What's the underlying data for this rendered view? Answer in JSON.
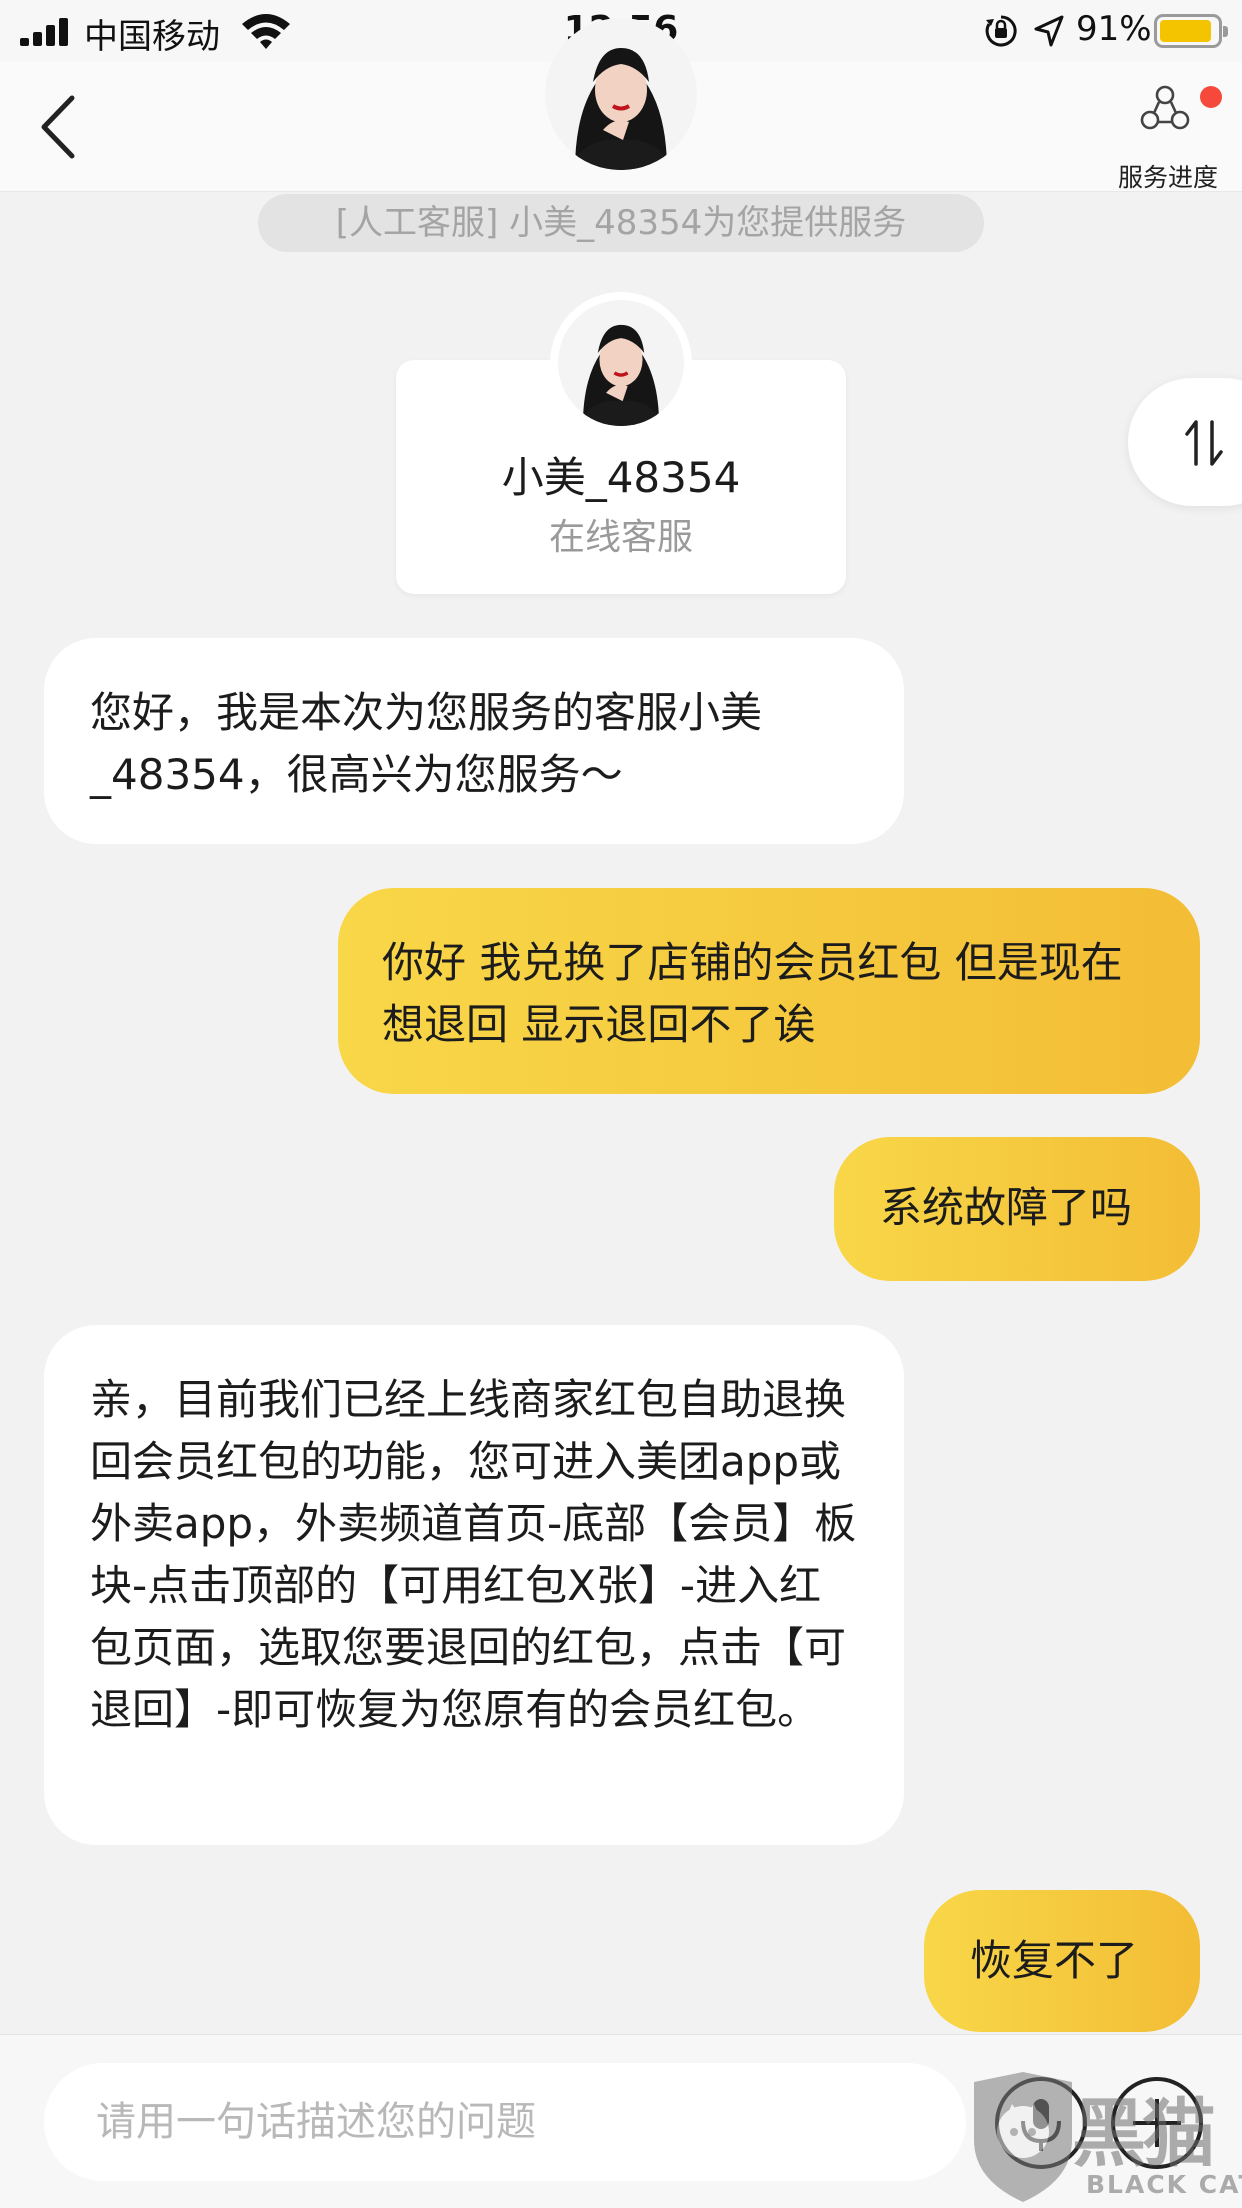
{
  "status_bar": {
    "carrier": "中国移动",
    "time": "12:56",
    "battery_percent": "91%",
    "battery_level": 0.91,
    "icons": [
      "signal-icon",
      "wifi-icon",
      "orientation-lock-icon",
      "location-arrow-icon",
      "battery-icon"
    ]
  },
  "nav": {
    "back_icon": "back-chevron-icon",
    "service_progress_label": "服务进度",
    "service_progress_icon": "network-nodes-icon"
  },
  "system_notice": "[人工客服] 小美_48354为您提供服务",
  "agent": {
    "name": "小美_48354",
    "role": "在线客服"
  },
  "messages": [
    {
      "side": "left",
      "text": "您好，我是本次为您服务的客服小美_48354，很高兴为您服务～"
    },
    {
      "side": "right",
      "text": "你好 我兑换了店铺的会员红包 但是现在想退回 显示退回不了诶"
    },
    {
      "side": "right",
      "text": "系统故障了吗"
    },
    {
      "side": "left",
      "text": "亲，目前我们已经上线商家红包自助退换回会员红包的功能，您可进入美团app或外卖app，外卖频道首页-底部【会员】板块-点击顶部的【可用红包X张】-进入红包页面，选取您要退回的红包，点击【可退回】-即可恢复为您原有的会员红包。"
    },
    {
      "side": "right",
      "text": "恢复不了"
    }
  ],
  "input": {
    "placeholder": "请用一句话描述您的问题",
    "value": ""
  },
  "watermark": {
    "glyph": "黑猫",
    "text": "BLACK CAT"
  },
  "colors": {
    "accent_yellow": "#f8d748",
    "accent_orange": "#f3bd35",
    "background": "#f2f2f2",
    "notify_red": "#f54a3b"
  }
}
